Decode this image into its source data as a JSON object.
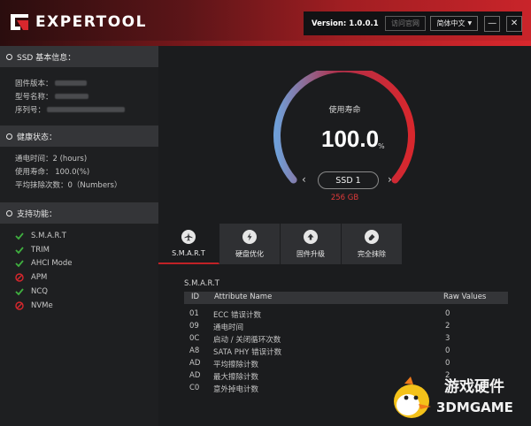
{
  "app": {
    "logo": "EXPERTOOL",
    "version": "Version: 1.0.0.1"
  },
  "header": {
    "official_site": "访问官网",
    "language": "简体中文",
    "minimize": "—",
    "close": "✕"
  },
  "sidebar": {
    "basic": {
      "title": "SSD 基本信息：",
      "firmware_label": "固件版本：",
      "model_label": "型号名称：",
      "serial_label": "序列号："
    },
    "health": {
      "title": "健康状态：",
      "power_on_time": "通电时间：2 (hours)",
      "life": "使用寿命： 100.0(%)",
      "avg_erase": "平均抹除次数：0（Numbers）"
    },
    "features": {
      "title": "支持功能：",
      "items": [
        {
          "label": "S.M.A.R.T",
          "supported": true
        },
        {
          "label": "TRIM",
          "supported": true
        },
        {
          "label": "AHCI Mode",
          "supported": true
        },
        {
          "label": "APM",
          "supported": false
        },
        {
          "label": "NCQ",
          "supported": true
        },
        {
          "label": "NVMe",
          "supported": false
        }
      ]
    }
  },
  "gauge": {
    "label": "使用寿命",
    "value": "100.0",
    "unit": "%",
    "percent": 100,
    "disk": "SSD 1",
    "capacity": "256 GB"
  },
  "tabs": [
    {
      "label": "S.M.A.R.T",
      "icon": "airplane-icon",
      "active": true
    },
    {
      "label": "硬盘优化",
      "icon": "lightning-icon",
      "active": false
    },
    {
      "label": "固件升级",
      "icon": "upload-icon",
      "active": false
    },
    {
      "label": "完全抹除",
      "icon": "eraser-icon",
      "active": false
    }
  ],
  "smart": {
    "title": "S.M.A.R.T",
    "columns": [
      "ID",
      "Attribute Name",
      "Raw Values"
    ],
    "rows": [
      {
        "id": "01",
        "name": "ECC 错误计数",
        "raw": "0"
      },
      {
        "id": "09",
        "name": "通电时间",
        "raw": "2"
      },
      {
        "id": "0C",
        "name": "启动 / 关闭循环次数",
        "raw": "3"
      },
      {
        "id": "A8",
        "name": "SATA PHY 错误计数",
        "raw": "0"
      },
      {
        "id": "AD",
        "name": "平均擦除计数",
        "raw": "0"
      },
      {
        "id": "AD",
        "name": "最大擦除计数",
        "raw": "2"
      },
      {
        "id": "C0",
        "name": "意外掉电计数",
        "raw": "2"
      }
    ]
  },
  "watermark": {
    "line1": "游戏硬件",
    "line2": "3DMGAME"
  },
  "colors": {
    "accent_red": "#c12126",
    "gauge_blue": "#6f9fd8",
    "supported_green": "#3fae3f",
    "unsupported_red": "#d8272d"
  }
}
